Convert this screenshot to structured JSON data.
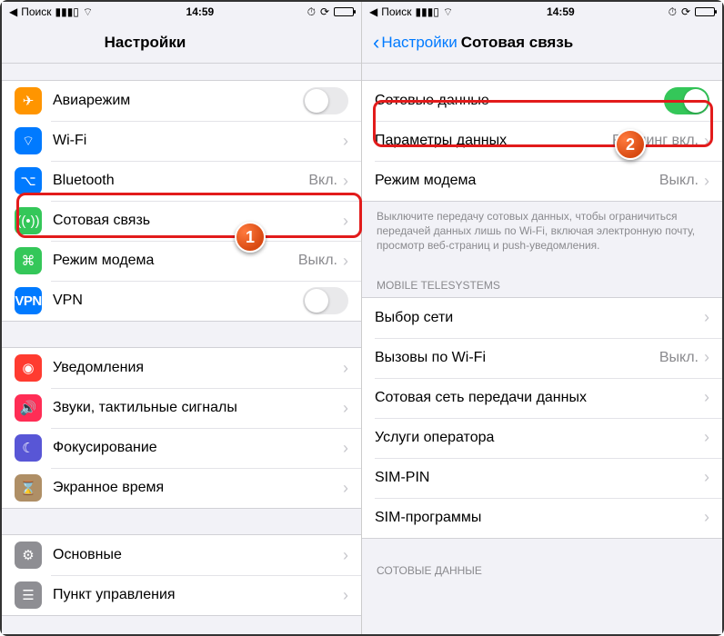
{
  "status": {
    "back_app": "Поиск",
    "time": "14:59"
  },
  "left": {
    "title": "Настройки",
    "g1": [
      {
        "icon": "airplane-icon",
        "bg": "bg-orange",
        "glyph": "✈",
        "label": "Авиарежим",
        "type": "toggle",
        "on": false
      },
      {
        "icon": "wifi-icon",
        "bg": "bg-blue",
        "glyph": "⌔",
        "label": "Wi-Fi",
        "type": "link",
        "value": ""
      },
      {
        "icon": "bluetooth-icon",
        "bg": "bg-blue",
        "glyph": "⌥",
        "label": "Bluetooth",
        "type": "link",
        "value": "Вкл."
      },
      {
        "icon": "cellular-icon",
        "bg": "bg-green",
        "glyph": "((•))",
        "label": "Сотовая связь",
        "type": "link",
        "value": ""
      },
      {
        "icon": "hotspot-icon",
        "bg": "bg-link",
        "glyph": "⌘",
        "label": "Режим модема",
        "type": "link",
        "value": "Выкл."
      },
      {
        "icon": "vpn-icon",
        "bg": "bg-vpn",
        "glyph": "VPN",
        "label": "VPN",
        "type": "toggle",
        "on": false
      }
    ],
    "g2": [
      {
        "icon": "notifications-icon",
        "bg": "bg-red",
        "glyph": "◉",
        "label": "Уведомления",
        "type": "link"
      },
      {
        "icon": "sounds-icon",
        "bg": "bg-pink",
        "glyph": "🔊",
        "label": "Звуки, тактильные сигналы",
        "type": "link"
      },
      {
        "icon": "focus-icon",
        "bg": "bg-indigo",
        "glyph": "☾",
        "label": "Фокусирование",
        "type": "link"
      },
      {
        "icon": "screen-time-icon",
        "bg": "bg-sand",
        "glyph": "⌛",
        "label": "Экранное время",
        "type": "link"
      }
    ],
    "g3": [
      {
        "icon": "general-icon",
        "bg": "bg-gray",
        "glyph": "⚙",
        "label": "Основные",
        "type": "link"
      },
      {
        "icon": "control-center-icon",
        "bg": "bg-gray",
        "glyph": "☰",
        "label": "Пункт управления",
        "type": "link"
      }
    ]
  },
  "right": {
    "back": "Настройки",
    "title": "Сотовая связь",
    "g1": [
      {
        "label": "Сотовые данные",
        "type": "toggle",
        "on": true
      },
      {
        "label": "Параметры данных",
        "type": "link",
        "value": "Роуминг вкл."
      },
      {
        "label": "Режим модема",
        "type": "link",
        "value": "Выкл."
      }
    ],
    "g1_footer": "Выключите передачу сотовых данных, чтобы ограничиться передачей данных лишь по Wi-Fi, включая электронную почту, просмотр веб-страниц и push-уведомления.",
    "g2_header": "MOBILE TELESYSTEMS",
    "g2": [
      {
        "label": "Выбор сети",
        "type": "link"
      },
      {
        "label": "Вызовы по Wi-Fi",
        "type": "link",
        "value": "Выкл."
      },
      {
        "label": "Сотовая сеть передачи данных",
        "type": "link"
      },
      {
        "label": "Услуги оператора",
        "type": "link"
      },
      {
        "label": "SIM-PIN",
        "type": "link"
      },
      {
        "label": "SIM-программы",
        "type": "link"
      }
    ],
    "g3_header": "СОТОВЫЕ ДАННЫЕ"
  },
  "badges": {
    "one": "1",
    "two": "2"
  }
}
